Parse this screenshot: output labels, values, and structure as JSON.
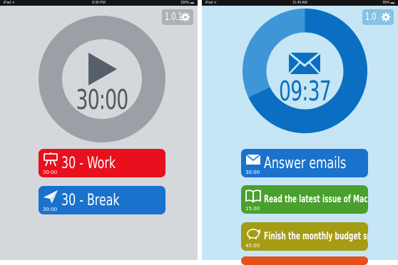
{
  "left": {
    "status": {
      "carrier": "iPad ᯤ",
      "time": "8:30 PM",
      "battery": "100% ▬"
    },
    "version": "1.0.1",
    "timer": "30:00",
    "tasks": [
      {
        "label": "30 - Work",
        "time": "30:00",
        "color": "#e8101c",
        "icon": "easel-icon"
      },
      {
        "label": "30 - Break",
        "time": "30:00",
        "color": "#1a72cc",
        "icon": "paper-plane-icon"
      }
    ]
  },
  "right": {
    "status": {
      "carrier": "iPad ᯤ",
      "time": "11:45 AM",
      "battery": "95% ▬"
    },
    "version": "1.0",
    "timer": "09:37",
    "progress_fraction": 0.68,
    "tasks": [
      {
        "label": "Answer emails",
        "time": "30:00",
        "color": "#1a72cc",
        "icon": "envelope-icon"
      },
      {
        "label": "Read the latest issue of Macworld",
        "time": "15:00",
        "color": "#4aa02c",
        "icon": "book-icon"
      },
      {
        "label": "Finish the monthly budget spreadsheet",
        "time": "45:00",
        "color": "#a59c15",
        "icon": "piggy-bank-icon"
      }
    ],
    "partial_task_color": "#e4521a"
  },
  "colors": {
    "left_bg": "#d5d8db",
    "left_ring": "#9aa0a6",
    "left_inner": "#d5d8db",
    "right_bg": "#c6e5f5",
    "ring_fill": "#0a6fc2",
    "ring_remaining": "#3e96d8"
  }
}
